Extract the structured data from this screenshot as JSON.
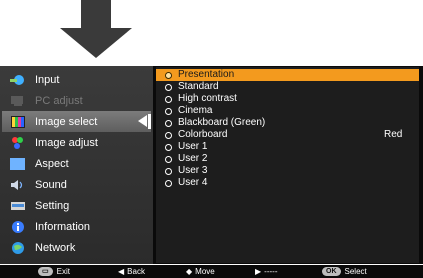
{
  "sidebar": {
    "items": [
      {
        "label": "Input",
        "icon": "input-icon"
      },
      {
        "label": "PC adjust",
        "icon": "pc-adjust-icon"
      },
      {
        "label": "Image select",
        "icon": "image-select-icon"
      },
      {
        "label": "Image adjust",
        "icon": "image-adjust-icon"
      },
      {
        "label": "Aspect",
        "icon": "aspect-icon"
      },
      {
        "label": "Sound",
        "icon": "sound-icon"
      },
      {
        "label": "Setting",
        "icon": "setting-icon"
      },
      {
        "label": "Information",
        "icon": "information-icon"
      },
      {
        "label": "Network",
        "icon": "network-icon"
      }
    ]
  },
  "options": {
    "items": [
      {
        "label": "Presentation",
        "value": ""
      },
      {
        "label": "Standard",
        "value": ""
      },
      {
        "label": "High contrast",
        "value": ""
      },
      {
        "label": "Cinema",
        "value": ""
      },
      {
        "label": "Blackboard (Green)",
        "value": ""
      },
      {
        "label": "Colorboard",
        "value": "Red"
      },
      {
        "label": "User 1",
        "value": ""
      },
      {
        "label": "User 2",
        "value": ""
      },
      {
        "label": "User 3",
        "value": ""
      },
      {
        "label": "User 4",
        "value": ""
      }
    ]
  },
  "footer": {
    "exit_key": "▭",
    "exit": "Exit",
    "back_glyph": "◀",
    "back": "Back",
    "move_glyph": "◆",
    "move": "Move",
    "next_glyph": "▶",
    "next": "-----",
    "ok_key": "OK",
    "select": "Select"
  },
  "colors": {
    "highlight": "#f39a1e",
    "menu_bg": "#0a0a0a"
  }
}
